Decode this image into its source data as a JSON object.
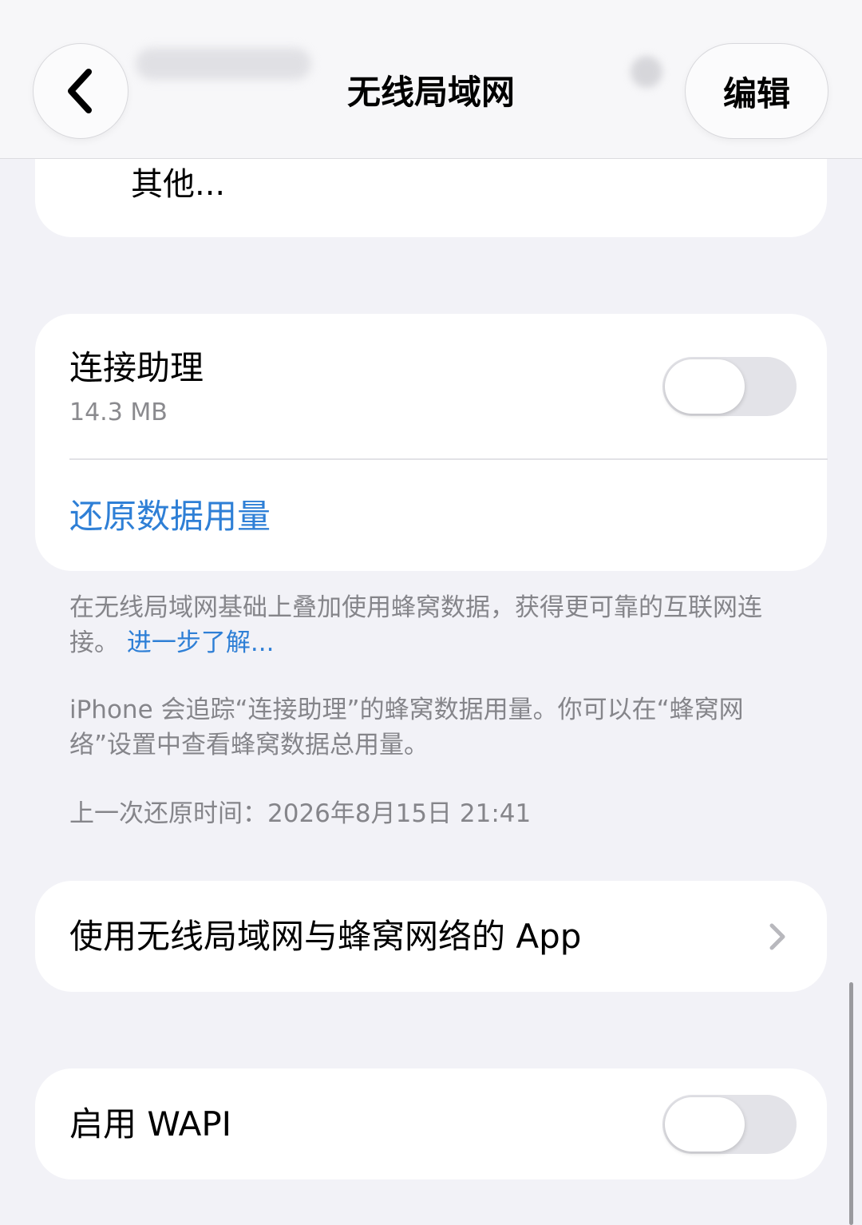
{
  "nav": {
    "title": "无线局域网",
    "edit_label": "编辑"
  },
  "other_row": {
    "label": "其他..."
  },
  "assist": {
    "label": "连接助理",
    "usage": "14.3 MB",
    "toggle_on": false,
    "reset_label": "还原数据用量"
  },
  "footnotes": {
    "description": "在无线局域网基础上叠加使用蜂窝数据，获得更可靠的互联网连接。",
    "learn_more": "进一步了解...",
    "tracking": "iPhone 会追踪“连接助理”的蜂窝数据用量。你可以在“蜂窝网络”设置中查看蜂窝数据总用量。",
    "last_reset": "上一次还原时间：2026年8月15日 21:41"
  },
  "apps_row": {
    "label": "使用无线局域网与蜂窝网络的 App"
  },
  "wapi": {
    "label": "启用 WAPI",
    "toggle_on": false
  },
  "colors": {
    "link_blue": "#2e7fd6",
    "background": "#f2f2f7",
    "toggle_off_track": "#e3e3e8"
  },
  "icons": {
    "back": "chevron-left-icon",
    "disclosure": "chevron-right-icon"
  }
}
